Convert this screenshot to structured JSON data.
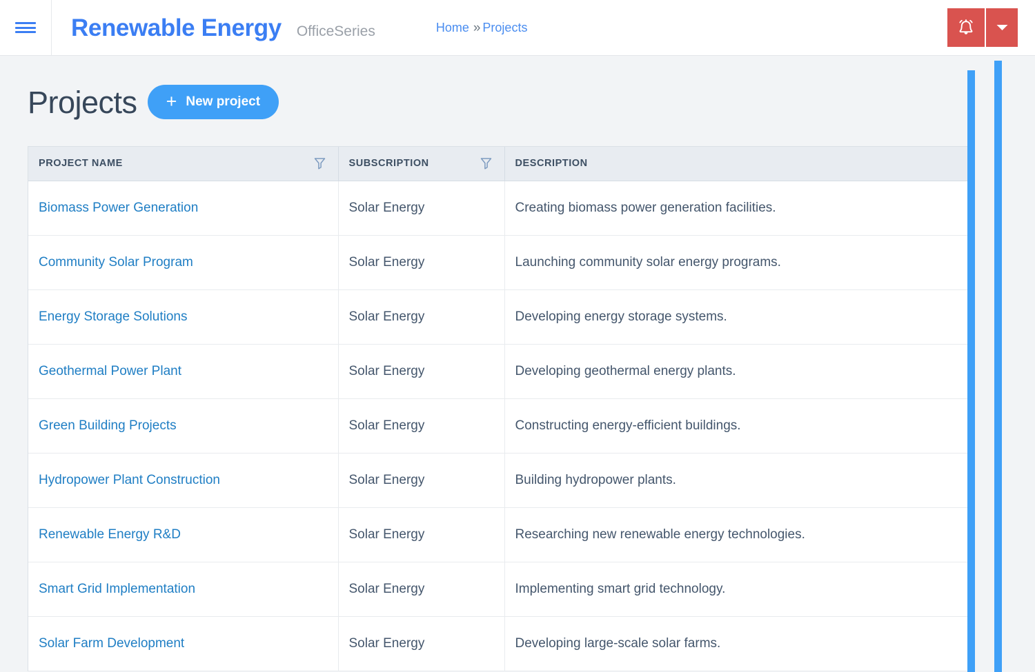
{
  "topbar": {
    "menu_icon": "hamburger-icon",
    "brand_title": "Renewable Energy",
    "brand_subtitle": "OfficeSeries",
    "breadcrumb": {
      "home": "Home",
      "separator": "»",
      "current": "Projects"
    },
    "actions": {
      "notifications_icon": "alarm-bell-icon",
      "dropdown_icon": "caret-down-icon",
      "accent_color": "#d9534f"
    }
  },
  "page": {
    "title": "Projects",
    "new_project_label": "New project",
    "new_project_icon": "plus-icon",
    "new_project_color": "#3fa0f7"
  },
  "table": {
    "columns": [
      {
        "label": "PROJECT NAME",
        "filterable": true,
        "filter_icon": "funnel-icon"
      },
      {
        "label": "SUBSCRIPTION",
        "filterable": true,
        "filter_icon": "funnel-icon"
      },
      {
        "label": "DESCRIPTION",
        "filterable": false,
        "filter_icon": ""
      }
    ],
    "rows": [
      {
        "name": "Biomass Power Generation",
        "subscription": "Solar Energy",
        "description": "Creating biomass power generation facilities."
      },
      {
        "name": "Community Solar Program",
        "subscription": "Solar Energy",
        "description": "Launching community solar energy programs."
      },
      {
        "name": "Energy Storage Solutions",
        "subscription": "Solar Energy",
        "description": "Developing energy storage systems."
      },
      {
        "name": "Geothermal Power Plant",
        "subscription": "Solar Energy",
        "description": "Developing geothermal energy plants."
      },
      {
        "name": "Green Building Projects",
        "subscription": "Solar Energy",
        "description": "Constructing energy-efficient buildings."
      },
      {
        "name": "Hydropower Plant Construction",
        "subscription": "Solar Energy",
        "description": "Building hydropower plants."
      },
      {
        "name": "Renewable Energy R&D",
        "subscription": "Solar Energy",
        "description": "Researching new renewable energy technologies."
      },
      {
        "name": "Smart Grid Implementation",
        "subscription": "Solar Energy",
        "description": "Implementing smart grid technology."
      },
      {
        "name": "Solar Farm Development",
        "subscription": "Solar Energy",
        "description": "Developing large-scale solar farms."
      }
    ]
  },
  "scrollbars": {
    "color": "#3fa0f7",
    "inner_name": "page-vertical-scrollbar",
    "outer_name": "window-vertical-scrollbar"
  }
}
